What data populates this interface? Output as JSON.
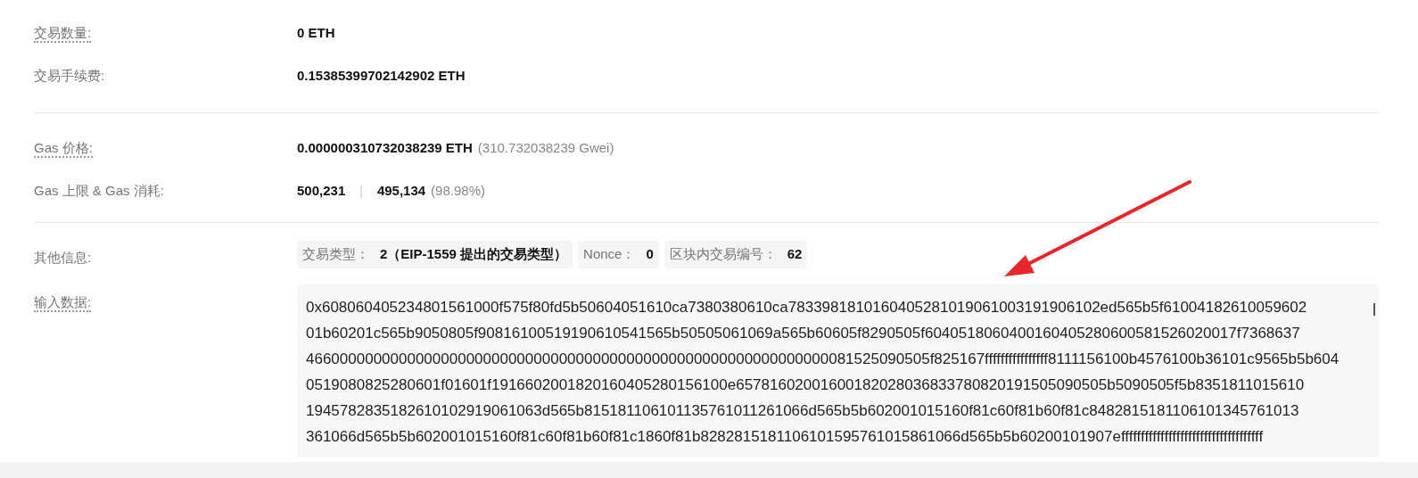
{
  "sections": [
    {
      "rows": [
        {
          "kind": "text",
          "label": "交易数量:",
          "hint": true,
          "value": "0 ETH"
        },
        {
          "kind": "text",
          "label": "交易手续费:",
          "hint": false,
          "value": "0.15385399702142902 ETH"
        }
      ]
    },
    {
      "rows": [
        {
          "kind": "text",
          "label": "Gas 价格:",
          "hint": true,
          "value": "0.000000310732038239 ETH",
          "note": "(310.732038239 Gwei)"
        },
        {
          "kind": "gas",
          "label": "Gas 上限 & Gas 消耗:",
          "hint": false,
          "limit": "500,231",
          "separator": "|",
          "used": "495,134",
          "note": "(98.98%)"
        }
      ]
    },
    {
      "rows": [
        {
          "kind": "tags",
          "label": "其他信息:",
          "hint": false,
          "tags": [
            {
              "label": "交易类型：",
              "value": "2（EIP-1559 提出的交易类型）"
            },
            {
              "label": "Nonce：",
              "value": "0"
            },
            {
              "label": "区块内交易编号：",
              "value": "62"
            }
          ]
        },
        {
          "kind": "input",
          "label": "输入数据:",
          "hint": true,
          "lines": [
            "0x608060405234801561000f575f80fd5b50604051610ca7380380610ca7833981810160405281019061003191906102ed565b5f61004182610059602",
            "01b60201c565b9050805f90816100519190610541565b50505061069a565b60605f8290505f6040518060400160405280600581526020017f7368637",
            "46600000000000000000000000000000000000000000000000000000000000081525090505f825167ffffffffffffffff8111156100b4576100b36101c9565b5b604",
            "0519080825280601f01601f1916602001820160405280156100e65781602001600182028036833780820191505090505b5090505f5b8351811015610",
            "1945782835182610102919061063d565b815181106101135761011261066d565b5b602001015160f81c60f81b60f81c8482815181106101345761013",
            "361066d565b5b602001015160f81c60f81b60f81c1860f81b8282815181106101595761015861066d565b5b60200101907effffffffffffffffffffffffffffffffffff"
          ]
        }
      ]
    }
  ]
}
